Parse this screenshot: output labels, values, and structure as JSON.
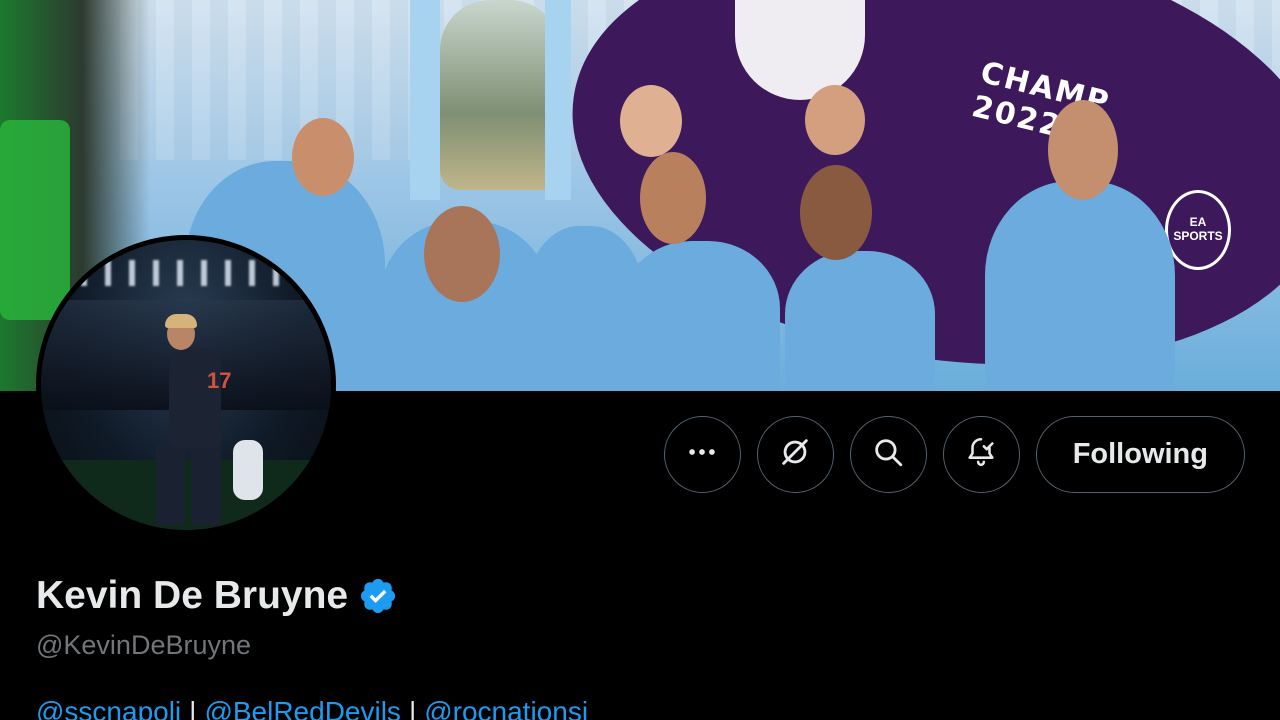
{
  "profile": {
    "display_name": "Kevin De Bruyne",
    "handle": "@KevinDeBruyne",
    "verified": true,
    "verified_color": "#1d9bf0",
    "bio_links": [
      "@sscnapoli",
      "@BelRedDevils",
      "@rocnationsi"
    ],
    "bio_separator": "|"
  },
  "banner": {
    "board_text": "CHAMP\n2022",
    "sponsor_text": "EA SPORTS"
  },
  "actions": {
    "more_icon": "more-horizontal-icon",
    "grok_icon": "grok-slash-icon",
    "search_icon": "search-icon",
    "notify_icon": "bell-check-icon",
    "follow_label": "Following"
  },
  "colors": {
    "background": "#000000",
    "text_primary": "#e7e9ea",
    "text_secondary": "#71767b",
    "link": "#1d9bf0",
    "button_border": "#536471"
  }
}
